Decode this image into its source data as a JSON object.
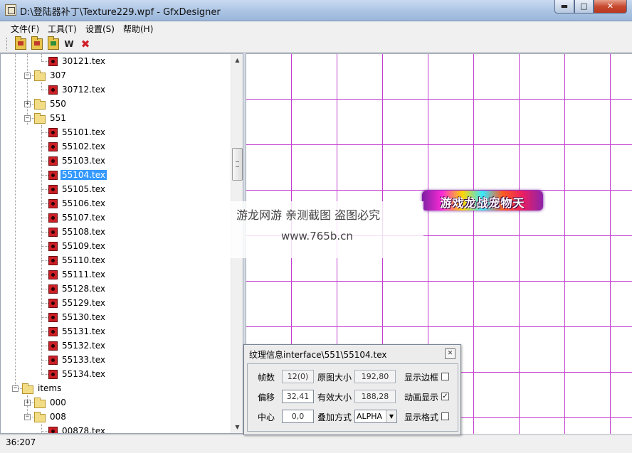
{
  "window": {
    "title": "D:\\登陆器补丁\\Texture229.wpf - GfxDesigner",
    "min_glyph": "▬",
    "max_glyph": "□",
    "close_glyph": "✕"
  },
  "menu": {
    "items": [
      "文件(F)",
      "工具(T)",
      "设置(S)",
      "帮助(H)"
    ]
  },
  "toolbar": {
    "w_label": "W",
    "x_glyph": "✖"
  },
  "tree": {
    "up_arrow": "▲",
    "down_arrow": "▼",
    "nodes": [
      {
        "label": "30121.tex",
        "kind": "file",
        "level": 2
      },
      {
        "label": "307",
        "kind": "folder",
        "level": 1,
        "expander": "−"
      },
      {
        "label": "30712.tex",
        "kind": "file",
        "level": 2
      },
      {
        "label": "550",
        "kind": "folder",
        "level": 1,
        "expander": "+"
      },
      {
        "label": "551",
        "kind": "folder",
        "level": 1,
        "expander": "−"
      },
      {
        "label": "55101.tex",
        "kind": "file",
        "level": 2
      },
      {
        "label": "55102.tex",
        "kind": "file",
        "level": 2
      },
      {
        "label": "55103.tex",
        "kind": "file",
        "level": 2
      },
      {
        "label": "55104.tex",
        "kind": "file",
        "level": 2,
        "selected": true
      },
      {
        "label": "55105.tex",
        "kind": "file",
        "level": 2
      },
      {
        "label": "55106.tex",
        "kind": "file",
        "level": 2
      },
      {
        "label": "55107.tex",
        "kind": "file",
        "level": 2
      },
      {
        "label": "55108.tex",
        "kind": "file",
        "level": 2
      },
      {
        "label": "55109.tex",
        "kind": "file",
        "level": 2
      },
      {
        "label": "55110.tex",
        "kind": "file",
        "level": 2
      },
      {
        "label": "55111.tex",
        "kind": "file",
        "level": 2
      },
      {
        "label": "55128.tex",
        "kind": "file",
        "level": 2
      },
      {
        "label": "55129.tex",
        "kind": "file",
        "level": 2
      },
      {
        "label": "55130.tex",
        "kind": "file",
        "level": 2
      },
      {
        "label": "55131.tex",
        "kind": "file",
        "level": 2
      },
      {
        "label": "55132.tex",
        "kind": "file",
        "level": 2
      },
      {
        "label": "55133.tex",
        "kind": "file",
        "level": 2
      },
      {
        "label": "55134.tex",
        "kind": "file",
        "level": 2
      },
      {
        "label": "items",
        "kind": "folder",
        "level": 0,
        "expander": "−"
      },
      {
        "label": "000",
        "kind": "folder",
        "level": 1,
        "expander": "+"
      },
      {
        "label": "008",
        "kind": "folder",
        "level": 1,
        "expander": "−"
      },
      {
        "label": "00878.tex",
        "kind": "file",
        "level": 2
      }
    ]
  },
  "canvas": {
    "sprite_text": "游戏龙战宠物天"
  },
  "watermark": {
    "line1": "游龙网游 亲测截图 盗图必究",
    "line2": "www.765b.cn"
  },
  "status": {
    "coords": "36:207"
  },
  "dialog": {
    "title": "纹理信息interface\\551\\55104.tex",
    "close_glyph": "✕",
    "frames_label": "帧数",
    "frames_value": "12(0)",
    "orig_size_label": "原图大小",
    "orig_size_value": "192,80",
    "show_border_label": "显示边框",
    "show_border_checked": false,
    "offset_label": "偏移",
    "offset_value": "32,41",
    "valid_size_label": "有效大小",
    "valid_size_value": "188,28",
    "anim_label": "动画显示",
    "anim_checked": true,
    "center_label": "中心",
    "center_value": "0,0",
    "blend_label": "叠加方式",
    "blend_value": "ALPHA",
    "blend_arrow": "▼",
    "show_format_label": "显示格式",
    "show_format_checked": false,
    "check_glyph": "✓"
  },
  "colors": {
    "grid": "#c33cd0",
    "selection": "#3399ff",
    "tex_icon": "#cc1f26"
  }
}
